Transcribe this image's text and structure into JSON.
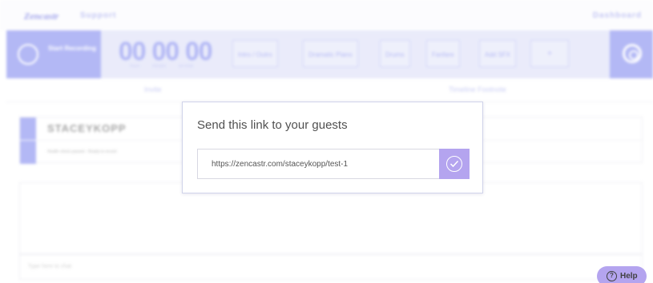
{
  "nav": {
    "logo": "Zencastr",
    "support": "Support",
    "dashboard": "Dashboard"
  },
  "toolbar": {
    "record_label": "Start Recording",
    "timer": "00 00 00",
    "timer_units": "hours minutes seconds",
    "tools": [
      "Intro / Outro",
      "Dramatic Piano",
      "Drums",
      "Fanfare",
      "Add SFX",
      "+"
    ]
  },
  "tabs": {
    "invite": "Invite",
    "timeline": "Timeline Footnote"
  },
  "guest": {
    "name": "STACEYKOPP",
    "status": "Health check passed - Ready to record"
  },
  "chat": {
    "placeholder": "Type here to chat"
  },
  "modal": {
    "title": "Send this link to your guests",
    "link": "https://zencastr.com/staceykopp/test-1",
    "copy_icon": "check-circle-icon"
  },
  "help": {
    "label": "Help",
    "icon": "question-circle-icon"
  },
  "colors": {
    "accent": "#6e78ec",
    "modal_button": "#b4a4ef",
    "help_button": "#b4a4ef"
  }
}
